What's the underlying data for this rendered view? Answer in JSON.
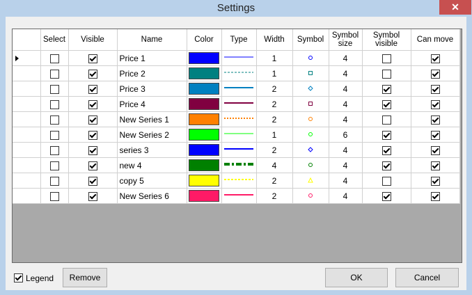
{
  "window": {
    "title": "Settings",
    "close_glyph": "✕"
  },
  "grid": {
    "headers": {
      "select": "Select",
      "visible": "Visible",
      "name": "Name",
      "color": "Color",
      "type": "Type",
      "width": "Width",
      "symbol": "Symbol",
      "symbol_size": [
        "Symbol",
        "size"
      ],
      "symbol_visible": [
        "Symbol",
        "visible"
      ],
      "can_move": "Can move"
    },
    "current_row": 0,
    "rows": [
      {
        "select": false,
        "visible": true,
        "name": "Price 1",
        "color": "#0000ff",
        "line_style": "solid",
        "width": "1",
        "symbol": "circle",
        "symbol_size": "4",
        "symbol_visible": false,
        "can_move": true
      },
      {
        "select": false,
        "visible": true,
        "name": "Price 2",
        "color": "#008080",
        "line_style": "dashed",
        "width": "1",
        "symbol": "square",
        "symbol_size": "4",
        "symbol_visible": false,
        "can_move": true
      },
      {
        "select": false,
        "visible": true,
        "name": "Price 3",
        "color": "#0080c0",
        "line_style": "solid",
        "width": "2",
        "symbol": "diamond",
        "symbol_size": "4",
        "symbol_visible": true,
        "can_move": true
      },
      {
        "select": false,
        "visible": true,
        "name": "Price 4",
        "color": "#800040",
        "line_style": "solid",
        "width": "2",
        "symbol": "square",
        "symbol_size": "4",
        "symbol_visible": true,
        "can_move": true
      },
      {
        "select": false,
        "visible": true,
        "name": "New Series 1",
        "color": "#ff8000",
        "line_style": "dotted",
        "width": "2",
        "symbol": "circle",
        "symbol_size": "4",
        "symbol_visible": false,
        "can_move": true
      },
      {
        "select": false,
        "visible": true,
        "name": "New Series 2",
        "color": "#00ff00",
        "line_style": "solid",
        "width": "1",
        "symbol": "circle",
        "symbol_size": "6",
        "symbol_visible": true,
        "can_move": true
      },
      {
        "select": false,
        "visible": true,
        "name": "series 3",
        "color": "#0000ff",
        "line_style": "solid",
        "width": "2",
        "symbol": "diamond",
        "symbol_size": "4",
        "symbol_visible": true,
        "can_move": true
      },
      {
        "select": false,
        "visible": true,
        "name": "new 4",
        "color": "#008000",
        "line_style": "dashdot",
        "width": "4",
        "symbol": "circle",
        "symbol_size": "4",
        "symbol_visible": true,
        "can_move": true
      },
      {
        "select": false,
        "visible": true,
        "name": "copy 5",
        "color": "#ffff00",
        "line_style": "dashed",
        "width": "2",
        "symbol": "triangle",
        "symbol_size": "4",
        "symbol_visible": false,
        "can_move": true
      },
      {
        "select": false,
        "visible": true,
        "name": "New Series 6",
        "color": "#ff1a66",
        "line_style": "solid",
        "width": "2",
        "symbol": "circle",
        "symbol_size": "4",
        "symbol_visible": true,
        "can_move": true
      }
    ]
  },
  "footer": {
    "legend_label": "Legend",
    "legend_checked": true,
    "remove_label": "Remove",
    "ok_label": "OK",
    "cancel_label": "Cancel"
  }
}
